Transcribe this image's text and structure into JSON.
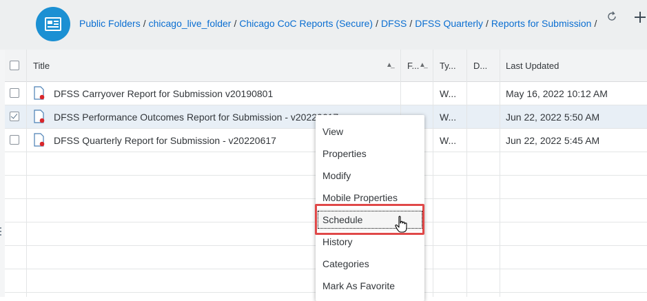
{
  "breadcrumb": [
    "Public Folders",
    "chicago_live_folder",
    "Chicago CoC Reports (Secure)",
    "DFSS",
    "DFSS Quarterly",
    "Reports for Submission"
  ],
  "breadcrumb_separator": "/",
  "header_buttons": [
    "refresh-icon",
    "add-icon"
  ],
  "table": {
    "columns": [
      "Title",
      "F...",
      "Ty...",
      "D...",
      "Last Updated"
    ],
    "rows": [
      {
        "title": "DFSS Carryover Report for Submission v20190801",
        "type": "W...",
        "last_updated": "May 16, 2022 10:12 AM",
        "checked": false
      },
      {
        "title": "DFSS Performance Outcomes Report for Submission - v20220617",
        "type": "W...",
        "last_updated": "Jun 22, 2022 5:50 AM",
        "checked": true
      },
      {
        "title": "DFSS Quarterly Report for Submission - v20220617",
        "type": "W...",
        "last_updated": "Jun 22, 2022 5:45 AM",
        "checked": false
      }
    ]
  },
  "context_menu": {
    "items": [
      "View",
      "Properties",
      "Modify",
      "Mobile Properties",
      "Schedule",
      "History",
      "Categories",
      "Mark As Favorite"
    ],
    "highlighted": "Schedule"
  },
  "colors": {
    "accent": "#0a6ed1",
    "folder_badge": "#1b90d3",
    "highlight_box": "#e04848",
    "selected_row": "#e8eff6"
  }
}
